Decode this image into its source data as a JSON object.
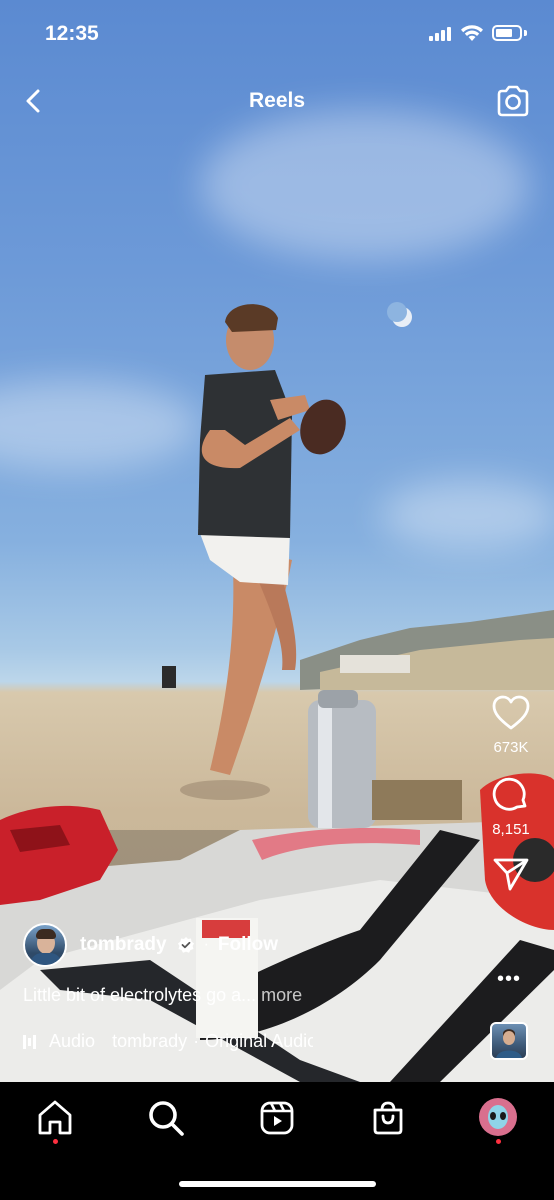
{
  "status_bar": {
    "time": "12:35"
  },
  "header": {
    "title": "Reels"
  },
  "actions": {
    "likes_count": "673K",
    "comments_count": "8,151"
  },
  "author": {
    "username": "tombrady",
    "follow_label": "Follow",
    "separator": "·"
  },
  "caption": {
    "text": "Little bit of electrolytes go a...",
    "more_label": "more"
  },
  "audio": {
    "label": "Audio",
    "artist": "tombrady",
    "separator": "·",
    "track": "Original Audio"
  },
  "tabs": [
    "home",
    "search",
    "reels",
    "shop",
    "profile"
  ],
  "colors": {
    "notification_dot": "#ff3040",
    "tab_background": "#000000"
  }
}
